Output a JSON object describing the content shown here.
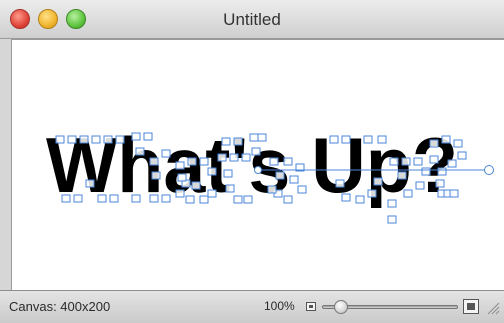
{
  "window": {
    "title": "Untitled",
    "controls": [
      "close",
      "minimize",
      "zoom"
    ]
  },
  "canvas": {
    "text": "What's Up?",
    "text_color": "#000000",
    "selection_color": "#4a86d8"
  },
  "status_bar": {
    "canvas_size": "Canvas: 400x200",
    "zoom": "100%",
    "zoom_slider_value": 0.1
  },
  "colors": {
    "close": "#e0453a",
    "minimize": "#f0b52d",
    "zoom": "#5fc43f"
  }
}
